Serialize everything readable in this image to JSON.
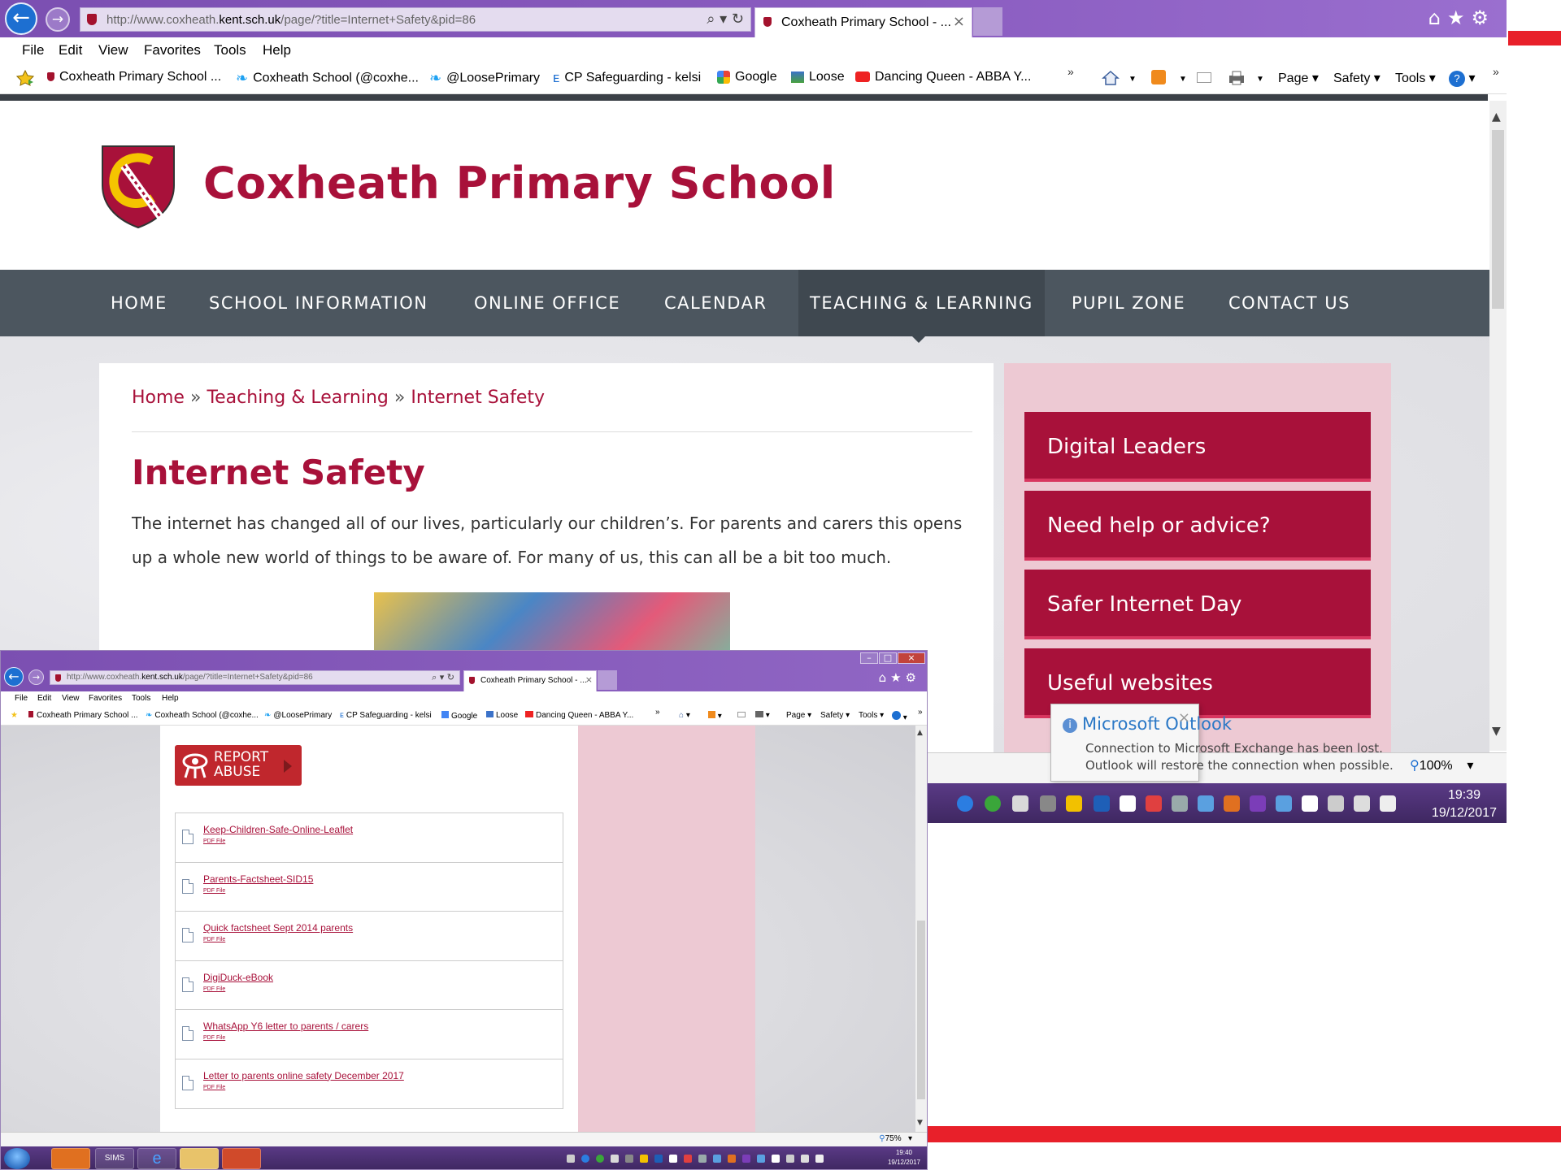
{
  "browser": {
    "url_prefix": "http://www.coxheath.",
    "url_domain": "kent.sch.uk",
    "url_suffix": "/page/?title=Internet+Safety&pid=86",
    "tab_title": "Coxheath Primary School - ...",
    "tab_close": "×",
    "addr_tools": "⌕ ▾ ↻",
    "right_icons": "⌂★⚙",
    "menu": [
      "File",
      "Edit",
      "View",
      "Favorites",
      "Tools",
      "Help"
    ],
    "favorites": [
      "Coxheath Primary School ...",
      "Coxheath School (@coxhe...",
      "@LoosePrimary",
      "CP Safeguarding - kelsi",
      "Google",
      "Loose",
      "Dancing Queen - ABBA Y..."
    ],
    "chevron": "»",
    "commands": [
      "Page ▾",
      "Safety ▾",
      "Tools ▾"
    ],
    "zoom": "100%",
    "zoom_caret": "▾"
  },
  "site": {
    "school_name": "Coxheath Primary School",
    "nav": [
      "HOME",
      "SCHOOL INFORMATION",
      "ONLINE OFFICE",
      "CALENDAR",
      "TEACHING & LEARNING",
      "PUPIL ZONE",
      "CONTACT US"
    ],
    "active_nav": "TEACHING & LEARNING",
    "breadcrumb": [
      "Home",
      "»",
      "Teaching & Learning",
      "»",
      "Internet Safety"
    ],
    "heading": "Internet Safety",
    "intro": "The internet has changed all of our lives, particularly our children’s. For parents and carers this opens up a whole new world of things to be aware of. For many of us, this can all be a bit too much.",
    "sidebar_links": [
      "Digital Leaders",
      "Need help or advice?",
      "Safer Internet Day",
      "Useful websites"
    ]
  },
  "notification": {
    "title": "Microsoft Outlook",
    "info_glyph": "i",
    "close": "×",
    "line1": "Connection to Microsoft Exchange has been lost.",
    "line2": "Outlook will restore the connection when possible."
  },
  "taskbar": {
    "time": "19:39",
    "date": "19/12/2017"
  },
  "window2": {
    "url_prefix": "http://www.coxheath.",
    "url_domain": "kent.sch.uk",
    "url_suffix": "/page/?title=Internet+Safety&pid=86",
    "tab_title": "Coxheath Primary School - ...",
    "tab_close": "×",
    "addr_tools": "⌕ ▾ ↻",
    "right_icons": "⌂★⚙",
    "menu": [
      "File",
      "Edit",
      "View",
      "Favorites",
      "Tools",
      "Help"
    ],
    "favorites": [
      "Coxheath Primary School ...",
      "Coxheath School (@coxhe...",
      "@LoosePrimary",
      "CP Safeguarding - kelsi",
      "Google",
      "Loose",
      "Dancing Queen - ABBA Y..."
    ],
    "chevron": "»",
    "commands": [
      "Page ▾",
      "Safety ▾",
      "Tools ▾"
    ],
    "report_line1": "REPORT",
    "report_line2": "ABUSE",
    "files": [
      {
        "name": "Keep-Children-Safe-Online-Leaflet",
        "type": "PDF File"
      },
      {
        "name": "Parents-Factsheet-SID15",
        "type": "PDF File"
      },
      {
        "name": "Quick factsheet Sept 2014 parents",
        "type": "PDF File"
      },
      {
        "name": "DigiDuck-eBook",
        "type": "PDF File"
      },
      {
        "name": "WhatsApp Y6 letter to parents / carers",
        "type": "PDF File"
      },
      {
        "name": "Letter to parents online safety December 2017",
        "type": "PDF File"
      }
    ],
    "zoom": "75%",
    "zoom_caret": "▾",
    "taskbar_sims": "SIMS",
    "time": "19:40",
    "date": "19/12/2017"
  },
  "colors": {
    "brand": "#a8113a",
    "nav_bg": "#4c565f",
    "sidebar_bg": "#edc9d3",
    "chrome": "#7b4fb1",
    "accent_red": "#e8202a"
  }
}
